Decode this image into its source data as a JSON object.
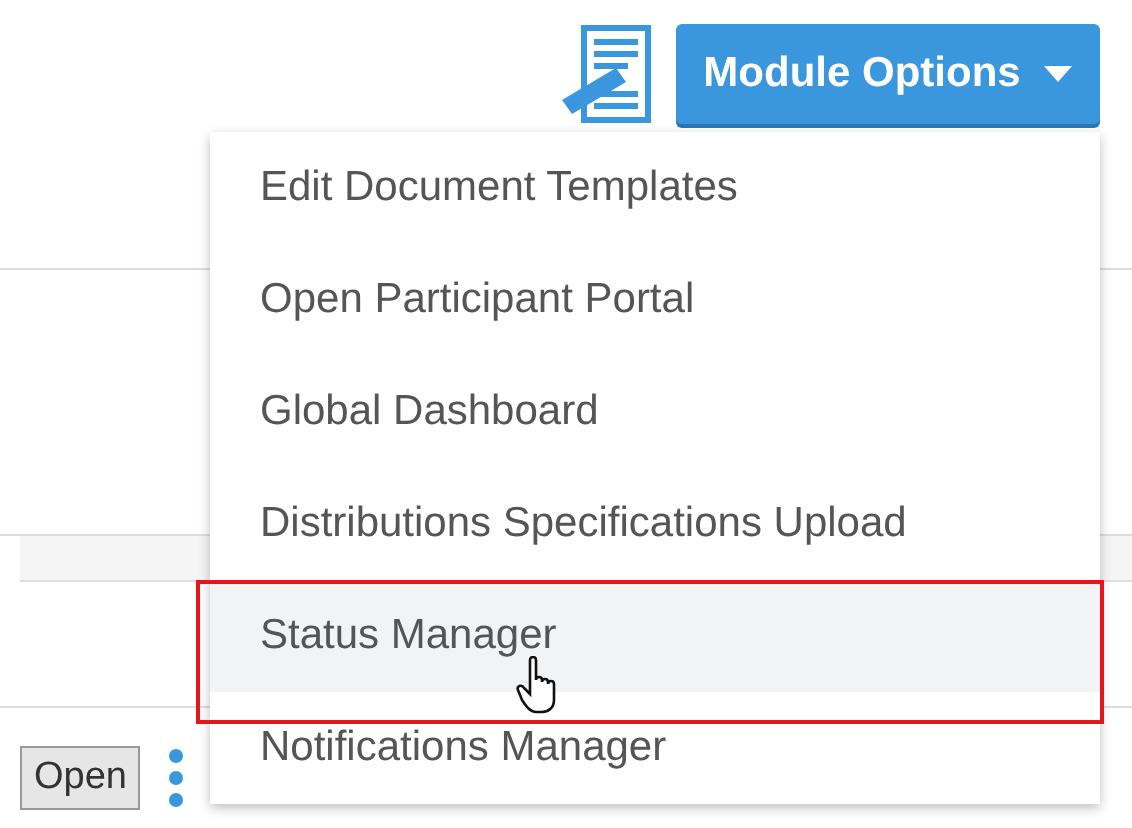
{
  "header": {
    "module_button": "Module Options"
  },
  "menu": {
    "items": [
      {
        "label": "Edit Document Templates",
        "selected": false
      },
      {
        "label": "Open Participant Portal",
        "selected": false
      },
      {
        "label": "Global Dashboard",
        "selected": false
      },
      {
        "label": "Distributions Specifications Upload",
        "selected": false
      },
      {
        "label": "Status Manager",
        "selected": true
      },
      {
        "label": "Notifications Manager",
        "selected": false
      }
    ]
  },
  "row": {
    "button": "Open"
  }
}
